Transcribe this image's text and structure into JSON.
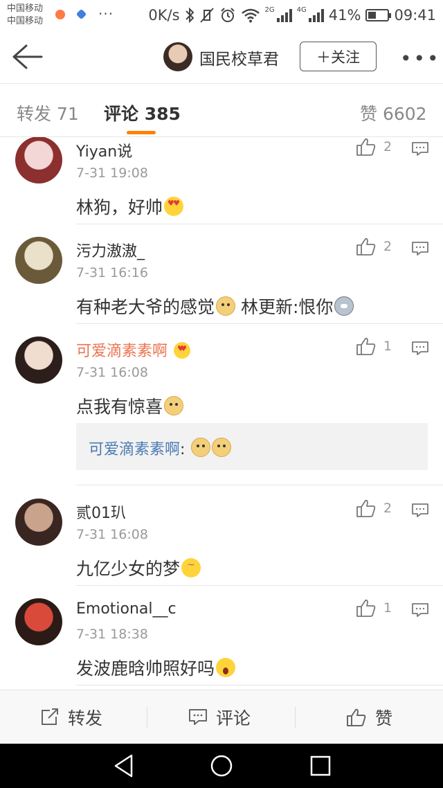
{
  "status_bar": {
    "carrier_1": "中国移动",
    "carrier_2": "中国移动",
    "dots": "···",
    "net_speed": "0K/s",
    "label_2g": "2G",
    "label_4g": "4G",
    "battery_percent": "41%",
    "battery_level": 0.41,
    "time": "09:41"
  },
  "header": {
    "back_icon": "arrow-left-icon",
    "username": "国民校草君",
    "follow_label": "＋关注",
    "more_icon": "more-dots-icon"
  },
  "tabs": {
    "repost": "转发 71",
    "comments": "评论 385",
    "likes": "赞 6602",
    "accent_color": "#ff8200"
  },
  "comments": [
    {
      "name": "Yiyan说",
      "time": "7-31 19:08",
      "text": "林狗，好帅",
      "emoji": "love",
      "likes": "2",
      "avatar_colors": [
        "#f3d6d6",
        "#8c2f2f"
      ]
    },
    {
      "name": "污力滶滶_",
      "time": "7-31 16:16",
      "text_1": "有种老大爷的感觉",
      "text_2": " 林更新:恨你",
      "emoji": "doge",
      "emoji_2": "husky",
      "likes": "2",
      "avatar_colors": [
        "#e9e1c9",
        "#6b5a3a"
      ]
    },
    {
      "name": "可爱滴素素啊",
      "time": "7-31 16:08",
      "text": "点我有惊喜",
      "emoji": "doge",
      "likes": "1",
      "vip": true,
      "reply_name": "可爱滴素素啊",
      "reply_colon": ": ",
      "avatar_colors": [
        "#f1ddd0",
        "#2b1e1b"
      ]
    },
    {
      "name": "贰01玐",
      "time": "7-31 16:08",
      "text": "九亿少女的梦",
      "emoji": "shy",
      "likes": "2",
      "avatar_colors": [
        "#c9a38b",
        "#3a2620"
      ]
    },
    {
      "name": "Emotional__c",
      "time": "7-31 18:38",
      "text": "发波鹿晗帅照好吗",
      "emoji": "shock",
      "likes": "1",
      "avatar_colors": [
        "#d94a3a",
        "#2b1a16"
      ]
    }
  ],
  "colors": {
    "vip_name": "#eb7350",
    "reply_name": "#4a7bb3"
  },
  "bottom_bar": {
    "repost_label": "转发",
    "comment_label": "评论",
    "like_label": "赞"
  },
  "nav_bar": {
    "back": "nav-back-icon",
    "home": "nav-home-icon",
    "recents": "nav-recents-icon"
  }
}
